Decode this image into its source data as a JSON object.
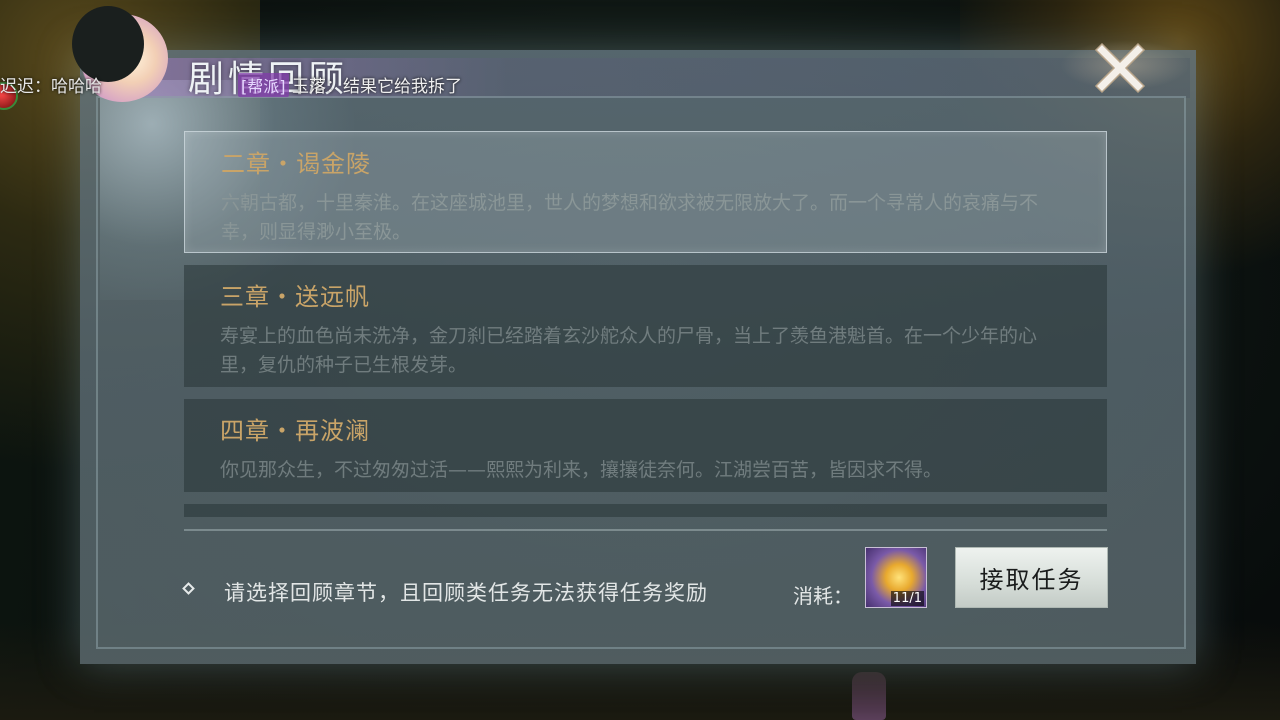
{
  "chat": {
    "left_fragment": "迟迟：哈哈哈",
    "channel_tag": "[帮派]",
    "message": "玉落：结果它给我拆了"
  },
  "panel": {
    "title": "剧情回顾"
  },
  "chapters": [
    {
      "title": "二章・谒金陵",
      "desc": "六朝古都，十里秦淮。在这座城池里，世人的梦想和欲求被无限放大了。而一个寻常人的哀痛与不幸，则显得渺小至极。",
      "selected": true
    },
    {
      "title": "三章・送远帆",
      "desc": "寿宴上的血色尚未洗净，金刀刹已经踏着玄沙舵众人的尸骨，当上了羡鱼港魁首。在一个少年的心里，复仇的种子已生根发芽。",
      "selected": false
    },
    {
      "title": "四章・再波澜",
      "desc": "你见那众生，不过匆匆过活——熙熙为利来，攘攘徒奈何。江湖尝百苦，皆因求不得。",
      "selected": false
    }
  ],
  "footer": {
    "hint": "请选择回顾章节，且回顾类任务无法获得任务奖励",
    "cost_label": "消耗：",
    "cost_count": "11/1",
    "accept_button": "接取任务"
  },
  "colors": {
    "chapter_title": "#c9a468",
    "panel_bg": "#5f7078",
    "accept_bg": "#dfe5e1"
  }
}
